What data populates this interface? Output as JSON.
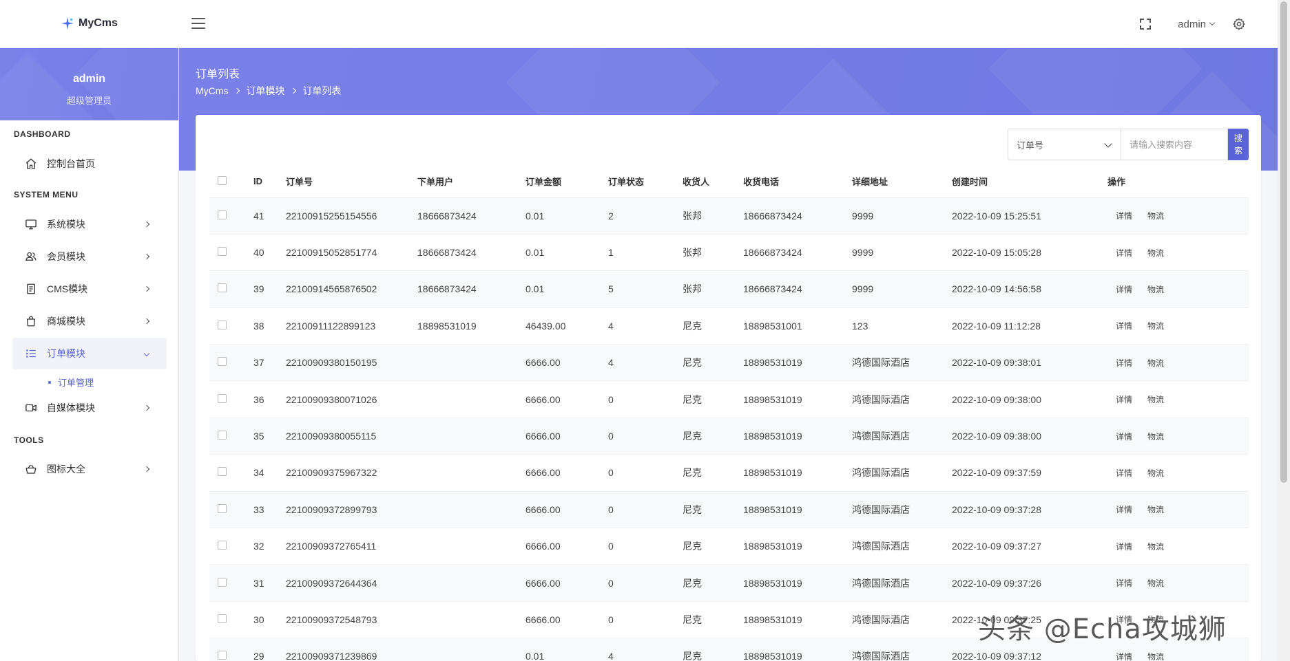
{
  "app": {
    "brand": "MyCms"
  },
  "topbar": {
    "user": "admin"
  },
  "sidebar": {
    "profile": {
      "name": "admin",
      "role": "超级管理员"
    },
    "sections": {
      "dashboard": "DASHBOARD",
      "system": "SYSTEM MENU",
      "tools": "TOOLS"
    },
    "items": [
      {
        "label": "控制台首页",
        "icon": "home-icon"
      },
      {
        "label": "系统模块",
        "icon": "monitor-icon"
      },
      {
        "label": "会员模块",
        "icon": "users-icon"
      },
      {
        "label": "CMS模块",
        "icon": "document-icon"
      },
      {
        "label": "商城模块",
        "icon": "shopping-bag-icon"
      },
      {
        "label": "订单模块",
        "icon": "list-icon"
      },
      {
        "label": "自媒体模块",
        "icon": "video-icon"
      },
      {
        "label": "图标大全",
        "icon": "basket-icon"
      }
    ],
    "sub_item": "订单管理"
  },
  "header": {
    "title": "订单列表",
    "breadcrumb": [
      "MyCms",
      "订单模块",
      "订单列表"
    ]
  },
  "search": {
    "field": "订单号",
    "placeholder": "请输入搜索内容",
    "button": "搜索"
  },
  "table": {
    "columns": [
      "ID",
      "订单号",
      "下单用户",
      "订单金额",
      "订单状态",
      "收货人",
      "收货电话",
      "详细地址",
      "创建时间",
      "操作"
    ],
    "actions": [
      "详情",
      "物流"
    ],
    "rows": [
      [
        "41",
        "22100915255154556",
        "18666873424",
        "0.01",
        "2",
        "张邦",
        "18666873424",
        "9999",
        "2022-10-09 15:25:51"
      ],
      [
        "40",
        "22100915052851774",
        "18666873424",
        "0.01",
        "1",
        "张邦",
        "18666873424",
        "9999",
        "2022-10-09 15:05:28"
      ],
      [
        "39",
        "22100914565876502",
        "18666873424",
        "0.01",
        "5",
        "张邦",
        "18666873424",
        "9999",
        "2022-10-09 14:56:58"
      ],
      [
        "38",
        "22100911122899123",
        "18898531019",
        "46439.00",
        "4",
        "尼克",
        "18898531001",
        "123",
        "2022-10-09 11:12:28"
      ],
      [
        "37",
        "22100909380150195",
        "",
        "6666.00",
        "4",
        "尼克",
        "18898531019",
        "鸿德国际酒店",
        "2022-10-09 09:38:01"
      ],
      [
        "36",
        "22100909380071026",
        "",
        "6666.00",
        "0",
        "尼克",
        "18898531019",
        "鸿德国际酒店",
        "2022-10-09 09:38:00"
      ],
      [
        "35",
        "22100909380055115",
        "",
        "6666.00",
        "0",
        "尼克",
        "18898531019",
        "鸿德国际酒店",
        "2022-10-09 09:38:00"
      ],
      [
        "34",
        "22100909375967322",
        "",
        "6666.00",
        "0",
        "尼克",
        "18898531019",
        "鸿德国际酒店",
        "2022-10-09 09:37:59"
      ],
      [
        "33",
        "22100909372899793",
        "",
        "6666.00",
        "0",
        "尼克",
        "18898531019",
        "鸿德国际酒店",
        "2022-10-09 09:37:28"
      ],
      [
        "32",
        "22100909372765411",
        "",
        "6666.00",
        "0",
        "尼克",
        "18898531019",
        "鸿德国际酒店",
        "2022-10-09 09:37:27"
      ],
      [
        "31",
        "22100909372644364",
        "",
        "6666.00",
        "0",
        "尼克",
        "18898531019",
        "鸿德国际酒店",
        "2022-10-09 09:37:26"
      ],
      [
        "30",
        "22100909372548793",
        "",
        "6666.00",
        "0",
        "尼克",
        "18898531019",
        "鸿德国际酒店",
        "2022-10-09 09:37:25"
      ],
      [
        "29",
        "22100909371239869",
        "",
        "0.01",
        "4",
        "尼克",
        "18898531019",
        "鸿德国际酒店",
        "2022-10-09 09:37:12"
      ]
    ]
  },
  "watermark": "头条 @Echa攻城狮",
  "colors": {
    "accent": "#5a63d8",
    "banner": "#767de6"
  }
}
